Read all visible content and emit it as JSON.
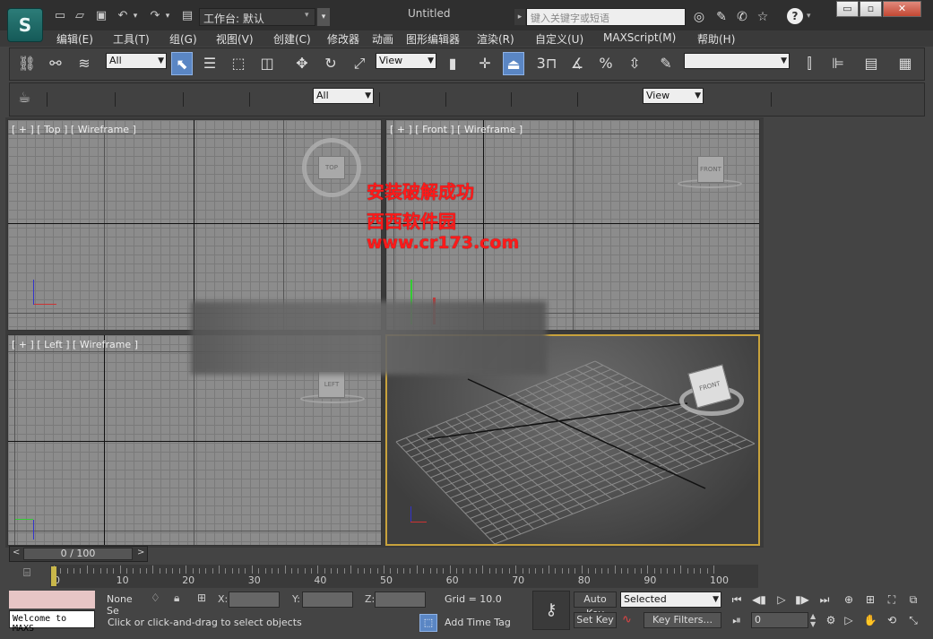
{
  "title_bar": {
    "logo": "S",
    "workspace_label": "工作台: 默认",
    "document_title": "Untitled",
    "search_placeholder": "键入关键字或短语",
    "min": "▭",
    "restore": "▫",
    "close": "✕"
  },
  "menu": [
    "编辑(E)",
    "工具(T)",
    "组(G)",
    "视图(V)",
    "创建(C)",
    "修改器",
    "动画",
    "图形编辑器",
    "渲染(R)",
    "自定义(U)",
    "MAXScript(M)",
    "帮助(H)"
  ],
  "toolbar": {
    "selection_filter": "All",
    "ref_coord": "View",
    "snap_3": "3",
    "named_selection": ""
  },
  "ribbon": {
    "filter": "All",
    "view": "View"
  },
  "viewports": {
    "top": {
      "label": "[ + ] [ Top ] [ Wireframe ]",
      "cube_text": "TOP"
    },
    "front": {
      "label": "[ + ] [ Front ] [ Wireframe ]",
      "cube_text": "FRONT"
    },
    "left": {
      "label": "[ + ] [ Left ] [ Wireframe ]",
      "cube_text": "LEFT"
    },
    "persp": {
      "label": "",
      "cube_text": "FRONT"
    }
  },
  "watermark": {
    "line1": "安装破解成功",
    "line2": "西西软件园",
    "line3": "www.cr173.com"
  },
  "time": {
    "slider": "0 / 100",
    "ticks": [
      "0",
      "10",
      "20",
      "30",
      "40",
      "50",
      "60",
      "70",
      "80",
      "90",
      "100"
    ]
  },
  "status": {
    "welcome": "Welcome to MAXS",
    "selection": "None Se",
    "x_label": "X:",
    "y_label": "Y:",
    "z_label": "Z:",
    "grid": "Grid = 10.0",
    "prompt": "Click or click-and-drag to select objects",
    "add_time_tag": "Add Time Tag",
    "auto_key": "Auto Key",
    "set_key": "Set Key",
    "key_mode": "Selected",
    "key_filters": "Key Filters...",
    "frame": "0"
  },
  "colors": {
    "accent": "#5a86c4",
    "active_viewport": "#c8a23c",
    "watermark": "#ff1a1a"
  }
}
